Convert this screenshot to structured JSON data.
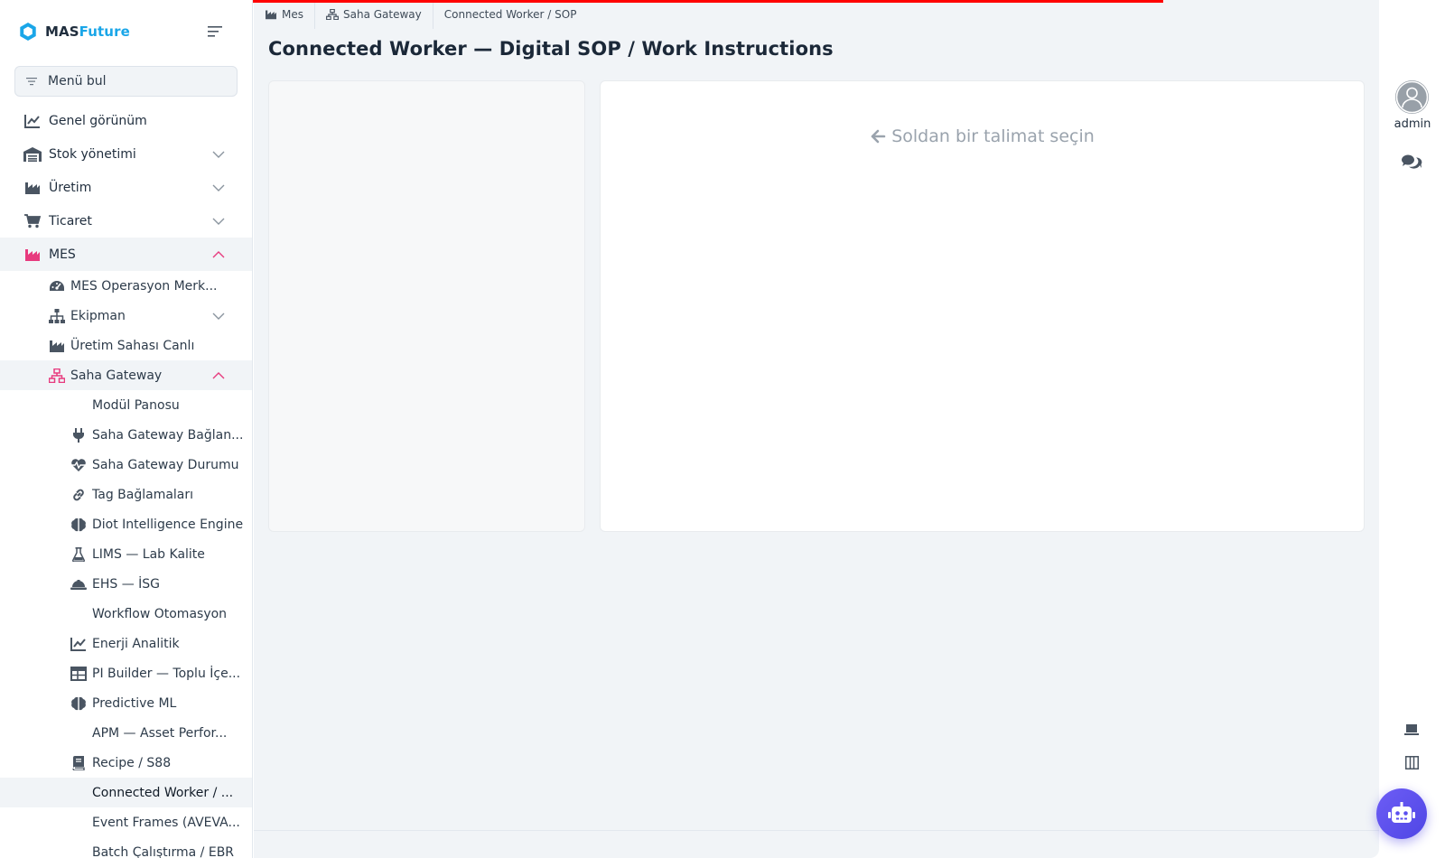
{
  "brand": {
    "name_part1": "MAS",
    "name_part2": "Future"
  },
  "menu_search": {
    "label": "Menü bul"
  },
  "colors": {
    "accent_pink": "#e73a7e",
    "brand_blue": "#1aa6e8",
    "progress_red": "#ff0000",
    "bot_purple": "#5b4ff0"
  },
  "sidebar": {
    "items": [
      {
        "label": "Genel görünüm",
        "icon": "chart-line-icon"
      },
      {
        "label": "Stok yönetimi",
        "icon": "warehouse-icon"
      },
      {
        "label": "Üretim",
        "icon": "industry-icon"
      },
      {
        "label": "Ticaret",
        "icon": "cart-icon"
      },
      {
        "label": "MES",
        "icon": "industry-icon"
      }
    ],
    "mes_children": [
      {
        "label": "MES Operasyon Merk...",
        "icon": "gauge-icon"
      },
      {
        "label": "Ekipman",
        "icon": "sitemap-icon"
      },
      {
        "label": "Üretim Sahası Canlı",
        "icon": "industry-icon"
      },
      {
        "label": "Saha Gateway",
        "icon": "network-icon"
      }
    ],
    "gateway_children": [
      {
        "label": "Modül Panosu"
      },
      {
        "label": "Saha Gateway Bağlan...",
        "icon": "plug-icon"
      },
      {
        "label": "Saha Gateway Durumu",
        "icon": "heart-pulse-icon"
      },
      {
        "label": "Tag Bağlamaları",
        "icon": "link-icon"
      },
      {
        "label": "Diot Intelligence Engine",
        "icon": "brain-icon"
      },
      {
        "label": "LIMS — Lab Kalite",
        "icon": "flask-icon"
      },
      {
        "label": "EHS — İSG",
        "icon": "helmet-icon"
      },
      {
        "label": "Workflow Otomasyon"
      },
      {
        "label": "Enerji Analitik",
        "icon": "chart-line-icon"
      },
      {
        "label": "PI Builder — Toplu İçe...",
        "icon": "table-icon"
      },
      {
        "label": "Predictive ML",
        "icon": "brain-icon"
      },
      {
        "label": "APM — Asset Perfor..."
      },
      {
        "label": "Recipe / S88",
        "icon": "book-icon"
      },
      {
        "label": "Connected Worker / ..."
      },
      {
        "label": "Event Frames (AVEVA..."
      },
      {
        "label": "Batch Çalıştırma / EBR"
      }
    ]
  },
  "breadcrumb": [
    {
      "label": "Mes",
      "icon": "industry-icon"
    },
    {
      "label": "Saha Gateway",
      "icon": "sitemap-icon"
    },
    {
      "label": "Connected Worker / SOP"
    }
  ],
  "page": {
    "title": "Connected Worker — Digital SOP / Work Instructions",
    "hint": "Soldan bir talimat seçin"
  },
  "user": {
    "name": "admin"
  }
}
